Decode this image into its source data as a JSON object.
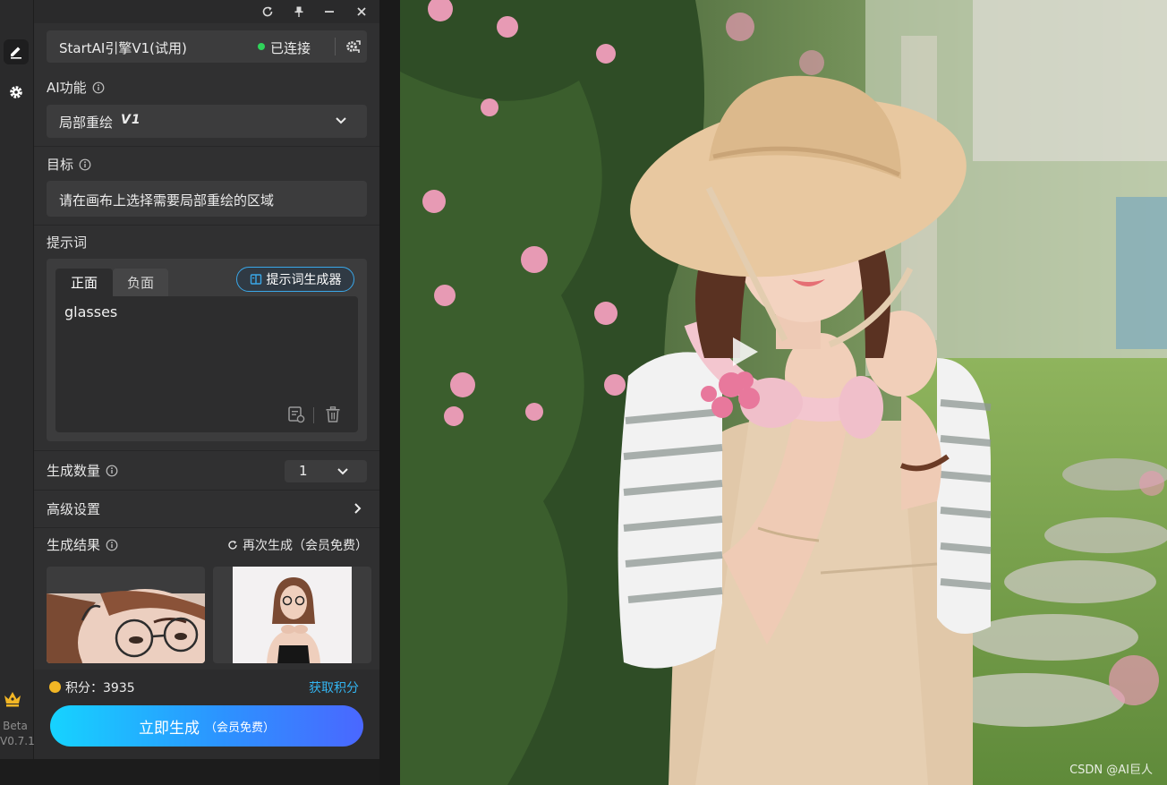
{
  "window": {
    "controls": [
      "refresh-icon",
      "pin-icon",
      "minimize-icon",
      "close-icon"
    ]
  },
  "rail": {
    "items": [
      "edit-icon",
      "settings-icon"
    ],
    "beta_label": "Beta",
    "version": "V0.7.1"
  },
  "engine": {
    "name": "StartAI引擎V1(试用)",
    "status": "已连接",
    "status_color": "#2fd35a"
  },
  "ai_function": {
    "label": "AI功能",
    "selected": "局部重绘",
    "badge": "V1"
  },
  "target": {
    "label": "目标",
    "text": "请在画布上选择需要局部重绘的区域"
  },
  "prompt": {
    "label": "提示词",
    "tab_positive": "正面",
    "tab_negative": "负面",
    "generator_button": "提示词生成器",
    "text": "glasses"
  },
  "count": {
    "label": "生成数量",
    "value": "1"
  },
  "advanced": {
    "label": "高级设置"
  },
  "results": {
    "label": "生成结果",
    "regenerate": "再次生成（会员免费）"
  },
  "footer": {
    "points": "积分：3935",
    "get_points": "获取积分",
    "generate_main": "立即生成",
    "generate_sub": "（会员免费）",
    "accent": "#2c93ff"
  },
  "canvas": {
    "watermark": "CSDN @AI巨人"
  }
}
